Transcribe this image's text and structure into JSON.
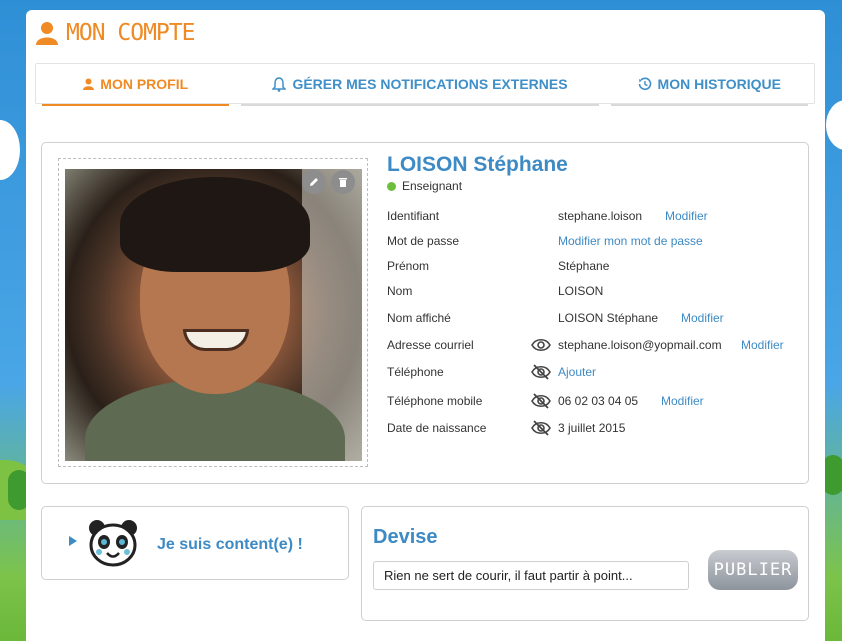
{
  "header": {
    "title": "MON COMPTE",
    "icon": "user-icon",
    "accent": "#f08a24"
  },
  "tabs": [
    {
      "label": "MON PROFIL",
      "icon": "user-icon",
      "active": true
    },
    {
      "label": "GÉRER MES NOTIFICATIONS EXTERNES",
      "icon": "bell-icon",
      "active": false
    },
    {
      "label": "MON HISTORIQUE",
      "icon": "history-icon",
      "active": false
    }
  ],
  "profile": {
    "name": "LOISON Stéphane",
    "role": "Enseignant",
    "role_status_color": "#6cbf3a",
    "fields": [
      {
        "label": "Identifiant",
        "value": "stephane.loison",
        "link": "Modifier",
        "visibility": ""
      },
      {
        "label": "Mot de passe",
        "value": "",
        "link": "Modifier mon mot de passe",
        "visibility": ""
      },
      {
        "label": "Prénom",
        "value": "Stéphane",
        "link": "",
        "visibility": ""
      },
      {
        "label": "Nom",
        "value": "LOISON",
        "link": "",
        "visibility": ""
      },
      {
        "label": "Nom affiché",
        "value": "LOISON Stéphane",
        "link": "Modifier",
        "visibility": ""
      },
      {
        "label": "Adresse courriel",
        "value": "stephane.loison@yopmail.com",
        "link": "Modifier",
        "visibility": "eye-icon"
      },
      {
        "label": "Téléphone",
        "value": "",
        "link": "Ajouter",
        "visibility": "eye-slash-icon"
      },
      {
        "label": "Téléphone mobile",
        "value": "06 02 03 04 05",
        "link": "Modifier",
        "visibility": "eye-slash-icon"
      },
      {
        "label": "Date de naissance",
        "value": "3 juillet 2015",
        "link": "",
        "visibility": "eye-slash-icon"
      }
    ]
  },
  "mood": {
    "text": "Je suis content(e) !",
    "icon": "panda-icon"
  },
  "devise": {
    "title": "Devise",
    "input_value": "Rien ne sert de courir, il faut partir à point...",
    "button_label": "PUBLIER"
  }
}
